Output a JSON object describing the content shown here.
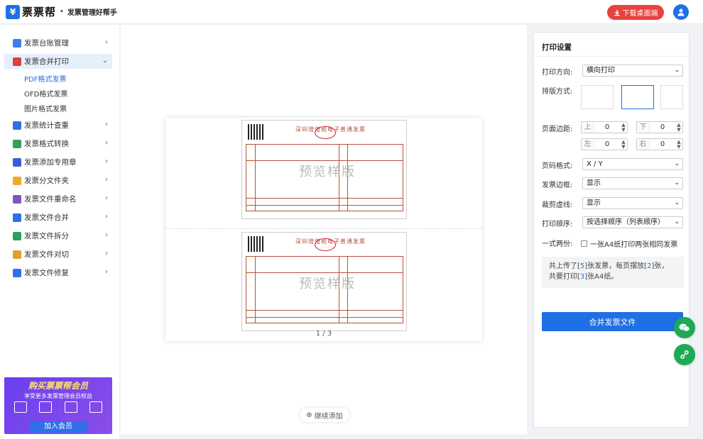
{
  "header": {
    "logo_mark": "¥",
    "app_name": "票票帮",
    "dot": "•",
    "slogan": "发票管理好帮手",
    "download_label": "下载桌面端"
  },
  "sidebar": {
    "items": [
      {
        "label": "发票台账管理",
        "icon": "ledger-icon",
        "color": "#3b7de9"
      },
      {
        "label": "发票合并打印",
        "icon": "printer-icon",
        "color": "#d9413b"
      },
      {
        "label": "发票统计查重",
        "icon": "stats-icon",
        "color": "#2f6fe8"
      },
      {
        "label": "发票格式转换",
        "icon": "convert-icon",
        "color": "#2fa05a"
      },
      {
        "label": "发票添加专用章",
        "icon": "stamp-icon",
        "color": "#3b5bdb"
      },
      {
        "label": "发票分文件夹",
        "icon": "folder-icon",
        "color": "#f0a928"
      },
      {
        "label": "发票文件重命名",
        "icon": "rename-icon",
        "color": "#7e57c2"
      },
      {
        "label": "发票文件合并",
        "icon": "merge-icon",
        "color": "#2f6fe8"
      },
      {
        "label": "发票文件拆分",
        "icon": "split-icon",
        "color": "#2fa05a"
      },
      {
        "label": "发票文件对切",
        "icon": "cut-icon",
        "color": "#e0a12a"
      },
      {
        "label": "发票文件修复",
        "icon": "repair-icon",
        "color": "#2f6fe8"
      }
    ],
    "subitems": [
      "PDF格式发票",
      "OFD格式发票",
      "图片格式发票"
    ],
    "promo": {
      "title": "购买票票帮会员",
      "subtitle": "享受更多发票管理会员权益",
      "button": "加入会员"
    }
  },
  "preview": {
    "invoice_title": "深圳增值税电子普通发票",
    "watermark": "预览样版",
    "page_indicator": "1 / 3",
    "continue_label": "继续添加"
  },
  "settings": {
    "title": "打印设置",
    "orientation": {
      "label": "打印方向:",
      "value": "横向打印"
    },
    "layout_label": "排版方式:",
    "margins": {
      "label": "页面边距:",
      "top": {
        "label": "上",
        "value": "0"
      },
      "bottom": {
        "label": "下",
        "value": "0"
      },
      "left": {
        "label": "左",
        "value": "0"
      },
      "right": {
        "label": "右",
        "value": "0"
      }
    },
    "page_number": {
      "label": "页码格式:",
      "value": "X / Y"
    },
    "border": {
      "label": "发票边框:",
      "value": "显示"
    },
    "cut_line": {
      "label": "裁剪虚线:",
      "value": "显示"
    },
    "order": {
      "label": "打印顺序:",
      "value": "按选择顺序（列表顺序）"
    },
    "duplicate": {
      "label": "一式两份:",
      "checkbox_label": "一张A4纸打印两张相同发票"
    },
    "summary": {
      "p1": "共上传了[",
      "uploaded": "5",
      "p2": "]张发票，每页摆放[",
      "per_page": "2",
      "p3": "]张，",
      "p4": "共要打印[",
      "sheets": "3",
      "p5": "]张A4纸。"
    },
    "merge_button": "合并发票文件"
  }
}
